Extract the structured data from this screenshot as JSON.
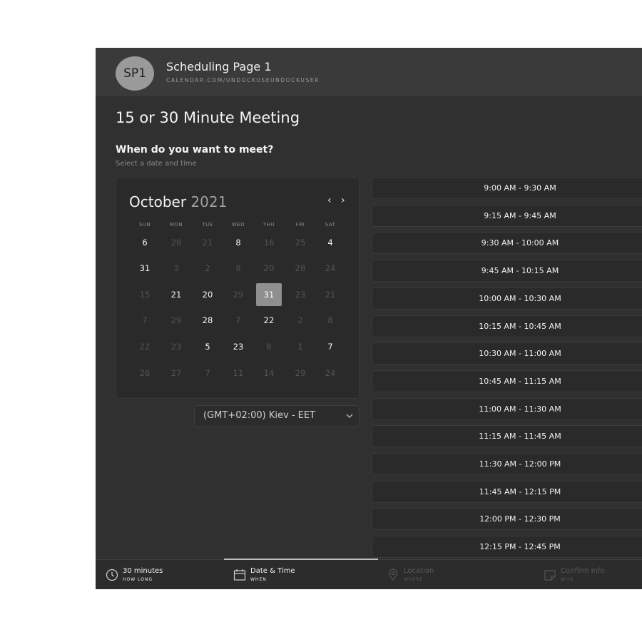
{
  "header": {
    "avatar_initials": "SP1",
    "page_name": "Scheduling Page 1",
    "page_url": "CALENDAR.COM/UNDOCKUSEUNDOCKUSER"
  },
  "meeting": {
    "title": "15 or 30 Minute Meeting",
    "question": "When do you want to meet?",
    "hint": "Select a date and time"
  },
  "calendar": {
    "month": "October",
    "year": "2021",
    "prev_label": "‹",
    "next_label": "›",
    "weekdays": [
      "SUN",
      "MON",
      "TUE",
      "WED",
      "THU",
      "FRI",
      "SAT"
    ],
    "weeks": [
      [
        "6",
        "28",
        "21",
        "8",
        "16",
        "25",
        "4"
      ],
      [
        "31",
        "3",
        "2",
        "8",
        "20",
        "28",
        "24"
      ],
      [
        "15",
        "21",
        "20",
        "29",
        "31",
        "23",
        "21"
      ],
      [
        "7",
        "29",
        "28",
        "7",
        "22",
        "2",
        "8"
      ],
      [
        "22",
        "23",
        "5",
        "23",
        "8",
        "1",
        "7"
      ],
      [
        "26",
        "27",
        "7",
        "11",
        "14",
        "29",
        "24"
      ]
    ],
    "available": [
      [
        1,
        0,
        0,
        1,
        0,
        0,
        1
      ],
      [
        1,
        0,
        0,
        0,
        0,
        0,
        0
      ],
      [
        0,
        1,
        1,
        0,
        1,
        0,
        0
      ],
      [
        0,
        0,
        1,
        0,
        1,
        0,
        0
      ],
      [
        0,
        0,
        1,
        1,
        0,
        0,
        1
      ],
      [
        0,
        0,
        0,
        0,
        0,
        0,
        0
      ]
    ],
    "selected": {
      "row": 2,
      "col": 4
    }
  },
  "timezone": {
    "value": "(GMT+02:00) Kiev - EET"
  },
  "time_slots": [
    "9:00 AM - 9:30 AM",
    "9:15 AM - 9:45 AM",
    "9:30 AM - 10:00 AM",
    "9:45 AM - 10:15 AM",
    "10:00 AM - 10:30 AM",
    "10:15 AM - 10:45 AM",
    "10:30 AM - 11:00 AM",
    "10:45 AM - 11:15 AM",
    "11:00 AM - 11:30 AM",
    "11:15 AM - 11:45 AM",
    "11:30 AM - 12:00 PM",
    "11:45 AM - 12:15 PM",
    "12:00 PM - 12:30 PM",
    "12:15 PM - 12:45 PM"
  ],
  "steps": [
    {
      "title": "30 minutes",
      "subtitle": "HOW LONG",
      "icon": "clock-icon",
      "state": "active"
    },
    {
      "title": "Date & Time",
      "subtitle": "WHEN",
      "icon": "calendar-icon",
      "state": "active"
    },
    {
      "title": "Location",
      "subtitle": "WHERE",
      "icon": "location-pin-icon",
      "state": "inactive"
    },
    {
      "title": "Confirm Info",
      "subtitle": "WHO",
      "icon": "note-icon",
      "state": "inactive"
    }
  ]
}
